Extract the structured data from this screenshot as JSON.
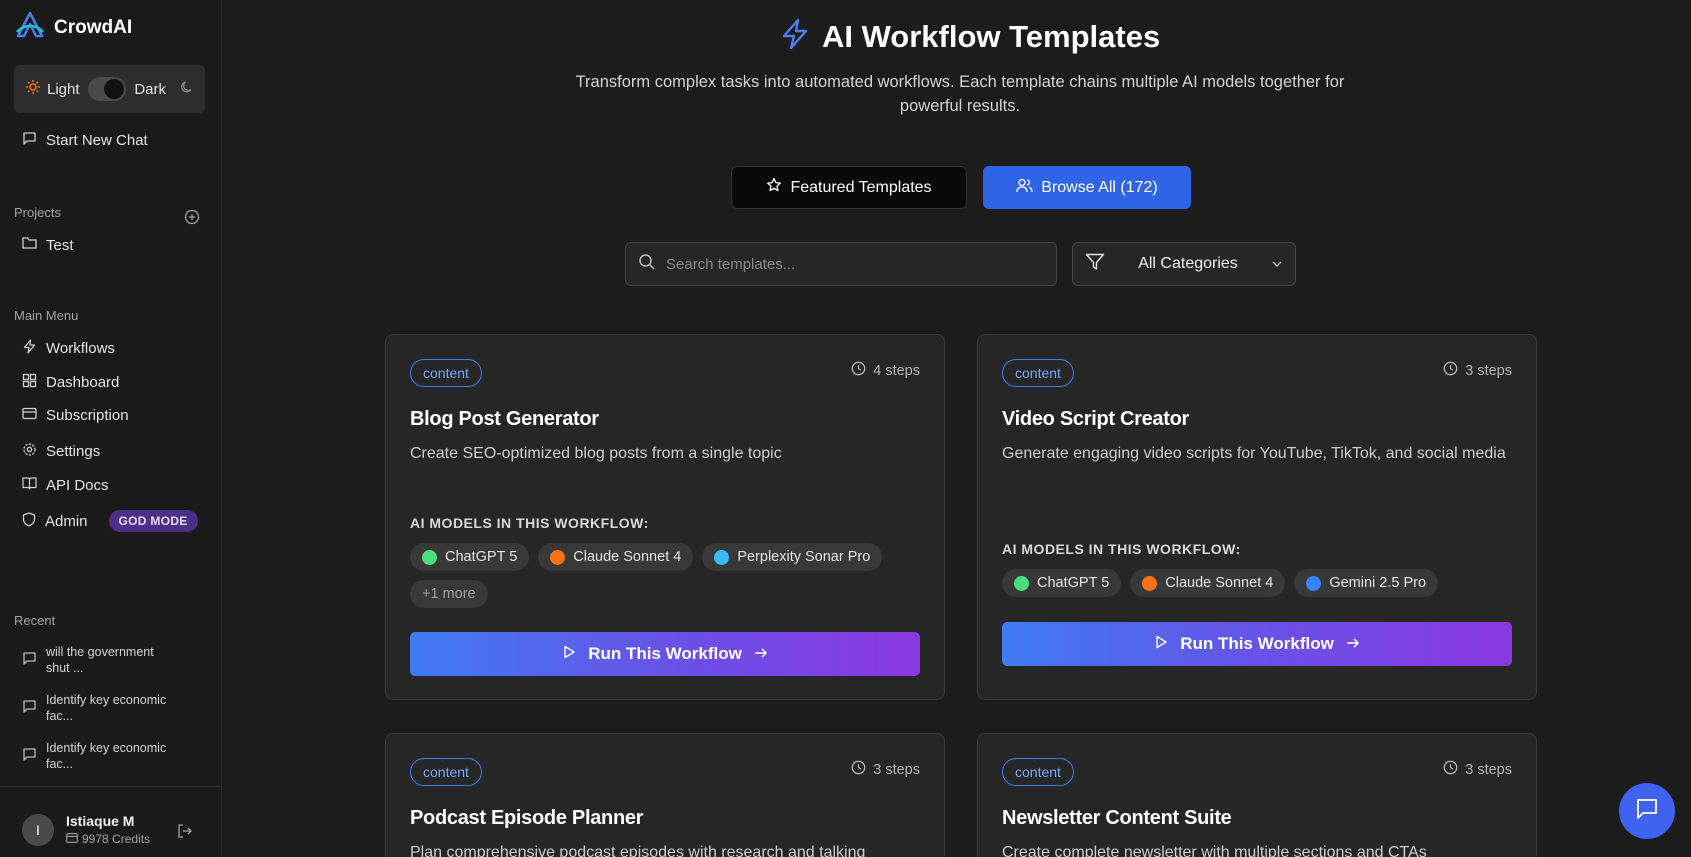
{
  "app": {
    "name": "CrowdAI"
  },
  "theme": {
    "light_label": "Light",
    "dark_label": "Dark"
  },
  "sidebar": {
    "new_chat": "Start New Chat",
    "projects_label": "Projects",
    "projects": [
      "Test"
    ],
    "main_menu_label": "Main Menu",
    "menu": [
      {
        "label": "Workflows",
        "icon": "zap-icon"
      },
      {
        "label": "Dashboard",
        "icon": "grid-icon"
      },
      {
        "label": "Subscription",
        "icon": "credit-card-icon"
      },
      {
        "label": "Settings",
        "icon": "gear-icon"
      },
      {
        "label": "API Docs",
        "icon": "book-icon"
      },
      {
        "label": "Admin",
        "icon": "shield-icon"
      }
    ],
    "admin_badge": "GOD MODE",
    "recent_label": "Recent",
    "recent": [
      "will the government shut ...",
      "Identify key economic fac...",
      "Identify key economic fac..."
    ]
  },
  "user": {
    "initial": "I",
    "name": "Istiaque M",
    "credits": "9978 Credits"
  },
  "header": {
    "title": "AI Workflow Templates",
    "subtitle": "Transform complex tasks into automated workflows. Each template chains multiple AI models together for powerful results."
  },
  "tabs": {
    "featured": "Featured Templates",
    "browse": "Browse All (172)"
  },
  "search": {
    "placeholder": "Search templates..."
  },
  "filter": {
    "selected": "All Categories"
  },
  "models_label": "AI MODELS IN THIS WORKFLOW:",
  "run_label": "Run This Workflow",
  "cards": [
    {
      "badge": "content",
      "steps": "4 steps",
      "title": "Blog Post Generator",
      "description": "Create SEO-optimized blog posts from a single topic",
      "models": [
        {
          "name": "ChatGPT 5",
          "color": "#4ade80"
        },
        {
          "name": "Claude Sonnet 4",
          "color": "#f97316"
        },
        {
          "name": "Perplexity Sonar Pro",
          "color": "#38bdf8"
        }
      ],
      "more": "+1 more"
    },
    {
      "badge": "content",
      "steps": "3 steps",
      "title": "Video Script Creator",
      "description": "Generate engaging video scripts for YouTube, TikTok, and social media",
      "models": [
        {
          "name": "ChatGPT 5",
          "color": "#4ade80"
        },
        {
          "name": "Claude Sonnet 4",
          "color": "#f97316"
        },
        {
          "name": "Gemini 2.5 Pro",
          "color": "#3b82f6"
        }
      ]
    },
    {
      "badge": "content",
      "steps": "3 steps",
      "title": "Podcast Episode Planner",
      "description": "Plan comprehensive podcast episodes with research and talking"
    },
    {
      "badge": "content",
      "steps": "3 steps",
      "title": "Newsletter Content Suite",
      "description": "Create complete newsletter with multiple sections and CTAs"
    }
  ]
}
